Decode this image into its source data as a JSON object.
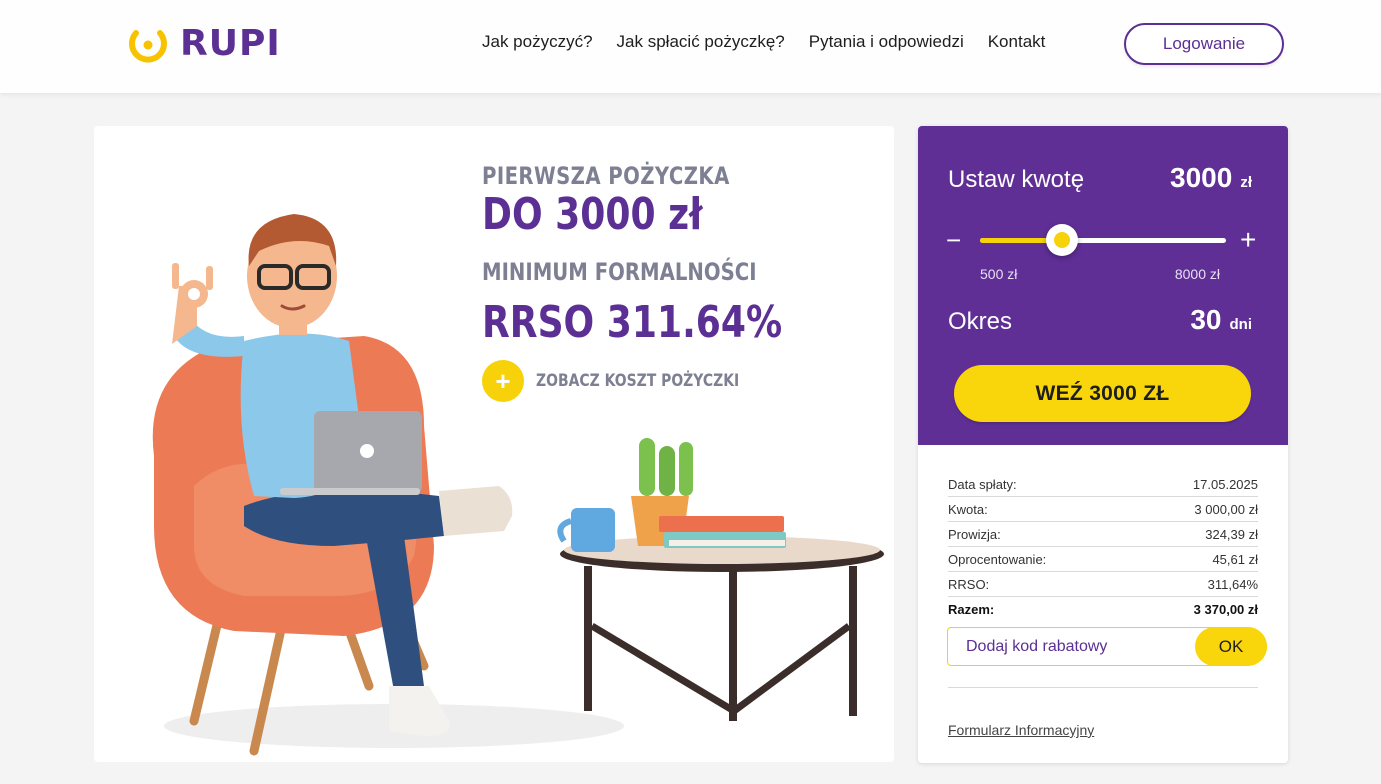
{
  "brand": {
    "logo_text": "RUPI",
    "primary": "#5f2f96",
    "accent": "#f9d60c"
  },
  "nav": {
    "items": [
      {
        "label": "Jak pożyczyć?"
      },
      {
        "label": "Jak spłacić pożyczkę?"
      },
      {
        "label": "Pytania i odpowiedzi"
      },
      {
        "label": "Kontakt"
      }
    ],
    "login_label": "Logowanie"
  },
  "hero": {
    "line1": "PIERWSZA POŻYCZKA",
    "line2": "DO 3000 zł",
    "line3": "MINIMUM FORMALNOŚCI",
    "line4": "RRSO 311.64%",
    "cost_link": "ZOBACZ KOSZT POŻYCZKI",
    "cost_icon": "+"
  },
  "calculator": {
    "amount_label": "Ustaw kwotę",
    "amount_value": "3000",
    "amount_unit": "zł",
    "minus": "−",
    "plus": "+",
    "range_min": "500 zł",
    "range_max": "8000 zł",
    "slider_fraction": 0.333,
    "period_label": "Okres",
    "period_value": "30",
    "period_unit": "dni",
    "cta": "WEŹ 3000 ZŁ"
  },
  "details": {
    "rows": [
      {
        "label": "Data spłaty:",
        "value": "17.05.2025"
      },
      {
        "label": "Kwota:",
        "value": "3 000,00 zł"
      },
      {
        "label": "Prowizja:",
        "value": "324,39 zł"
      },
      {
        "label": "Oprocentowanie:",
        "value": "45,61 zł"
      },
      {
        "label": "RRSO:",
        "value": "311,64%"
      }
    ],
    "total_label": "Razem:",
    "total_value": "3 370,00 zł"
  },
  "promo": {
    "placeholder": "Dodaj kod rabatowy",
    "ok": "OK"
  },
  "form_link": "Formularz Informacyjny"
}
